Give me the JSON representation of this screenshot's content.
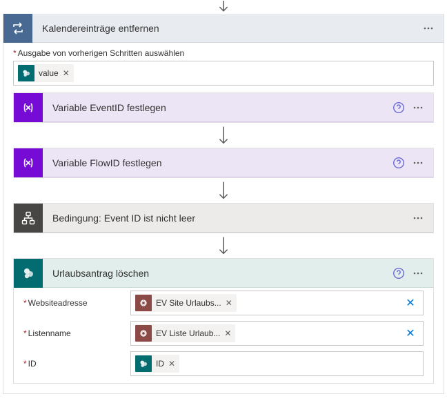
{
  "loop": {
    "title": "Kalendereinträge entfernen",
    "select_label": "Ausgabe von vorherigen Schritten auswählen",
    "value_token": "value"
  },
  "steps": {
    "var_event": "Variable EventID festlegen",
    "var_flow": "Variable FlowID festlegen",
    "condition": "Bedingung: Event ID ist nicht leer",
    "delete": "Urlaubsantrag löschen"
  },
  "delete_params": {
    "site_label": "Websiteadresse",
    "site_token": "EV Site Urlaubs...",
    "list_label": "Listenname",
    "list_token": "EV Liste Urlaub...",
    "id_label": "ID",
    "id_token": "ID"
  }
}
